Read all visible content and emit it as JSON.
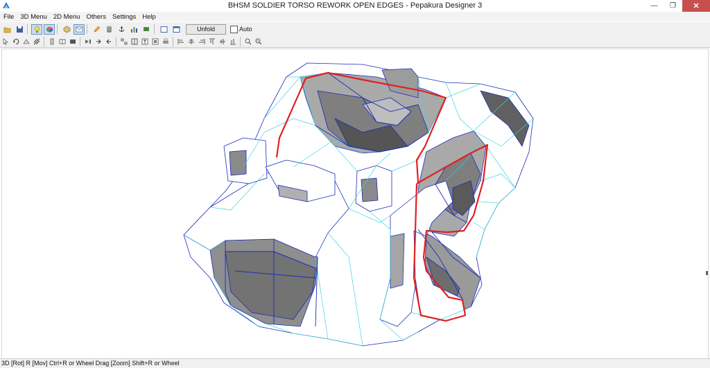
{
  "window": {
    "title": "BHSM SOLDIER TORSO REWORK OPEN EDGES - Pepakura Designer 3",
    "minimize_glyph": "—",
    "restore_glyph": "❐",
    "close_glyph": "✕"
  },
  "menu": {
    "items": [
      "File",
      "3D Menu",
      "2D Menu",
      "Others",
      "Settings",
      "Help"
    ]
  },
  "toolbar1": {
    "icons": [
      "open-icon",
      "save-icon",
      "lightbulb-icon",
      "cube-color-icon",
      "box-3d-icon",
      "envelope-icon",
      "pencil-icon",
      "cylinder-icon",
      "anchor-icon",
      "chart-icon",
      "flag-icon",
      "layout-icon",
      "window-icon"
    ],
    "unfold_label": "Unfold",
    "auto_label": "Auto"
  },
  "toolbar2": {
    "icons": [
      "select-icon",
      "rotate-icon",
      "join-icon",
      "scale-icon",
      "tab-icon",
      "edge-icon",
      "move-icon",
      "flip-icon",
      "rotate-part-icon",
      "link-icon",
      "split-icon",
      "join-part-icon",
      "text-icon",
      "image-icon",
      "print-icon",
      "align-left-icon",
      "align-center-icon",
      "align-right-icon",
      "align-top-icon",
      "align-middle-icon",
      "align-bottom-icon",
      "zoom-in-icon",
      "zoom-out-icon"
    ]
  },
  "status": {
    "text": "3D [Rot] R [Mov] Ctrl+R or Wheel Drag [Zoom] Shift+R or Wheel"
  },
  "colors": {
    "close_button": "#c7504f",
    "open_edge": "#e02020",
    "mesh_edge_blue": "#1a2ab8",
    "mesh_edge_cyan": "#3fd2e0"
  }
}
